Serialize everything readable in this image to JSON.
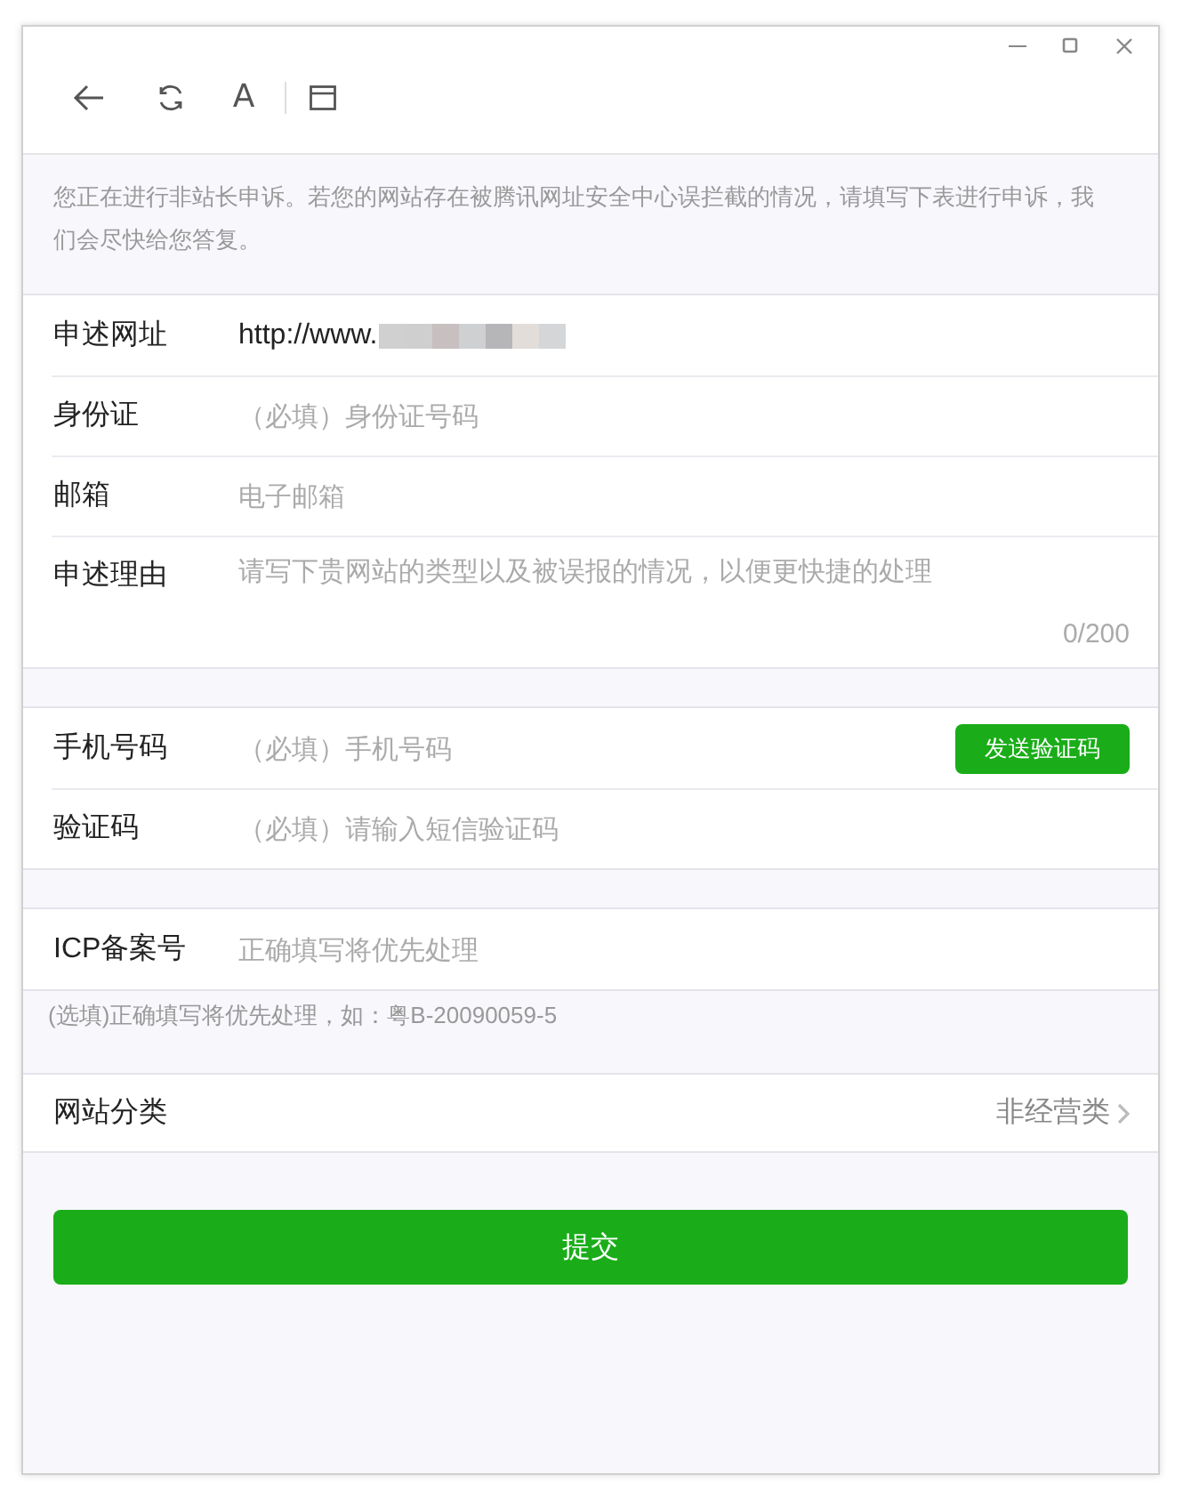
{
  "toolbar": {
    "font_button": "A"
  },
  "notice": "您正在进行非站长申诉。若您的网站存在被腾讯网址安全中心误拦截的情况，请填写下表进行申诉，我们会尽快给您答复。",
  "groups": [
    {
      "fields": [
        {
          "kind": "text",
          "label": "申述网址",
          "value": "http://www."
        },
        {
          "kind": "input",
          "label": "身份证",
          "placeholder": "（必填）身份证号码"
        },
        {
          "kind": "input",
          "label": "邮箱",
          "placeholder": "电子邮箱"
        },
        {
          "kind": "textarea",
          "label": "申述理由",
          "placeholder": "请写下贵网站的类型以及被误报的情况，以便更快捷的处理",
          "counter": "0/200"
        }
      ]
    },
    {
      "fields": [
        {
          "kind": "input_button",
          "label": "手机号码",
          "placeholder": "（必填）手机号码",
          "button": "发送验证码"
        },
        {
          "kind": "input",
          "label": "验证码",
          "placeholder": "（必填）请输入短信验证码"
        }
      ]
    },
    {
      "fields": [
        {
          "kind": "input",
          "label": "ICP备案号",
          "placeholder": "正确填写将优先处理"
        }
      ],
      "hint": "(选填)正确填写将优先处理，如：粤B-20090059-5"
    },
    {
      "fields": [
        {
          "kind": "select",
          "label": "网站分类",
          "value": "非经营类"
        }
      ]
    }
  ],
  "submit": "提交"
}
